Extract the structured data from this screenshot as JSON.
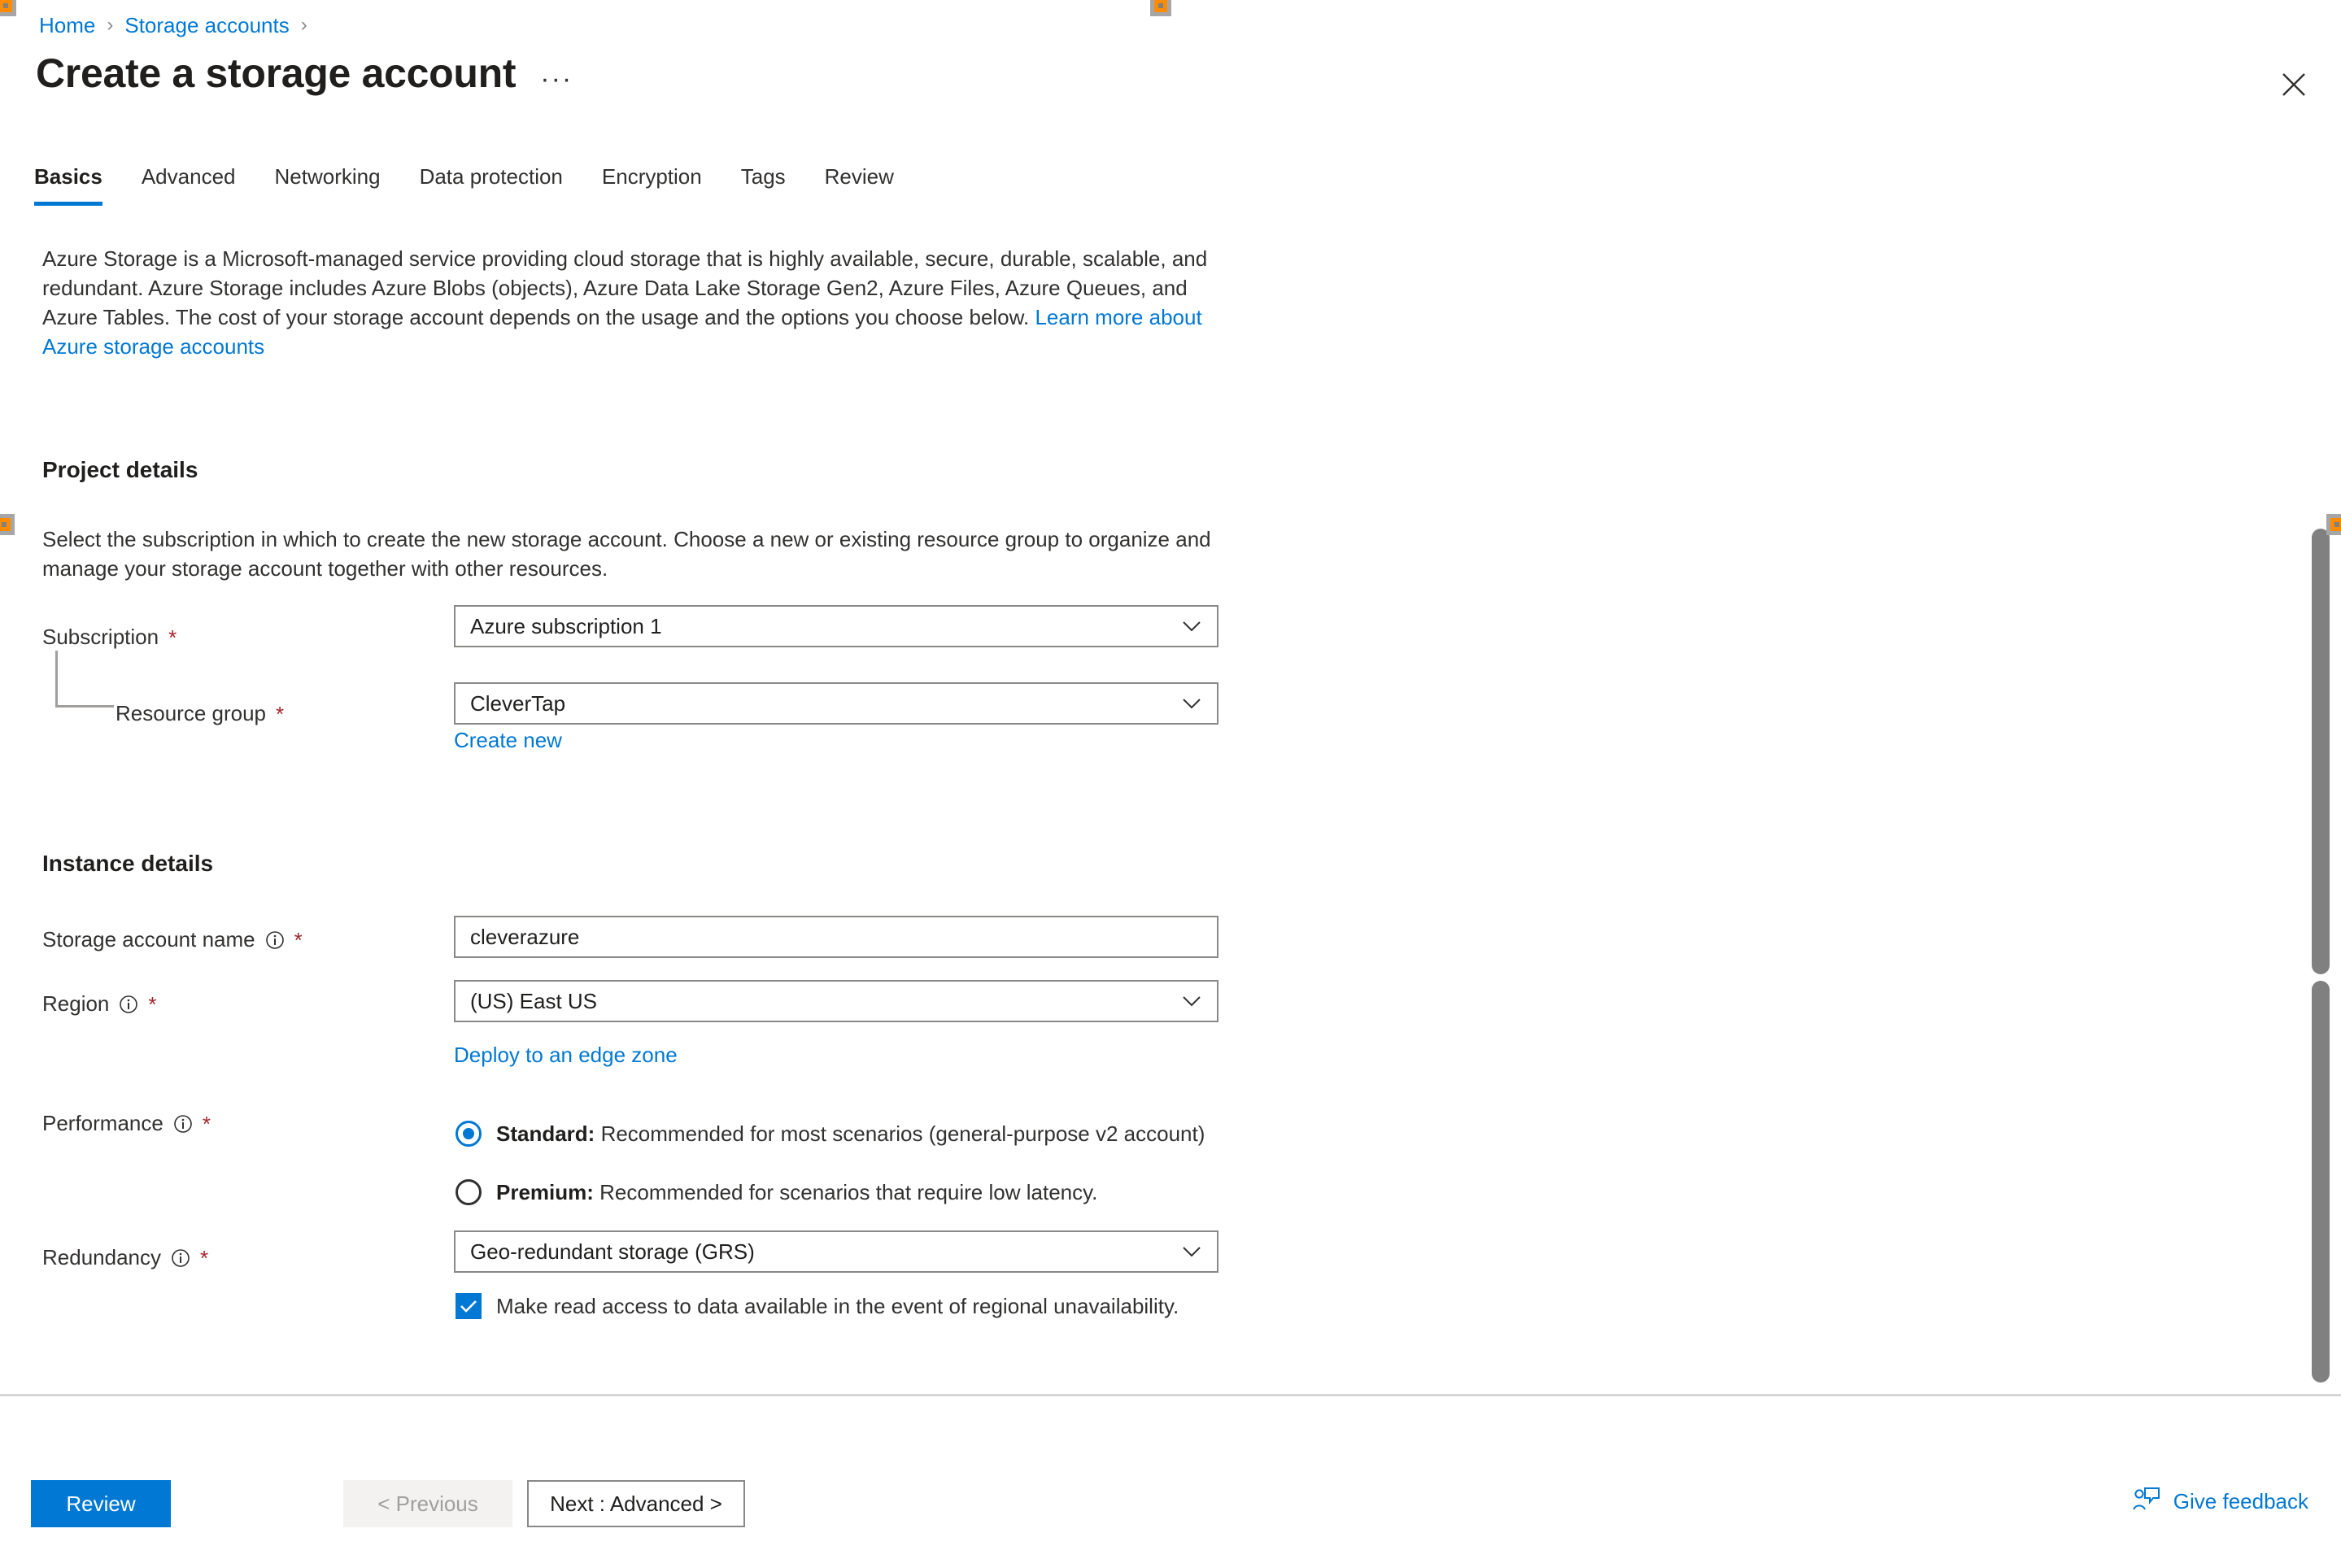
{
  "breadcrumb": {
    "items": [
      {
        "label": "Home"
      },
      {
        "label": "Storage accounts"
      }
    ],
    "separator": "›"
  },
  "header": {
    "title": "Create a storage account",
    "ellipsis": "···",
    "close_label": "Close"
  },
  "tabs": [
    {
      "label": "Basics",
      "active": true
    },
    {
      "label": "Advanced",
      "active": false
    },
    {
      "label": "Networking",
      "active": false
    },
    {
      "label": "Data protection",
      "active": false
    },
    {
      "label": "Encryption",
      "active": false
    },
    {
      "label": "Tags",
      "active": false
    },
    {
      "label": "Review",
      "active": false
    }
  ],
  "intro": {
    "text": "Azure Storage is a Microsoft-managed service providing cloud storage that is highly available, secure, durable, scalable, and redundant. Azure Storage includes Azure Blobs (objects), Azure Data Lake Storage Gen2, Azure Files, Azure Queues, and Azure Tables. The cost of your storage account depends on the usage and the options you choose below. ",
    "link": "Learn more about Azure storage accounts"
  },
  "project_details": {
    "heading": "Project details",
    "description": "Select the subscription in which to create the new storage account. Choose a new or existing resource group to organize and manage your storage account together with other resources.",
    "subscription": {
      "label": "Subscription",
      "required": "*",
      "value": "Azure subscription 1"
    },
    "resource_group": {
      "label": "Resource group",
      "required": "*",
      "value": "CleverTap",
      "create_new": "Create new"
    }
  },
  "instance_details": {
    "heading": "Instance details",
    "storage_account_name": {
      "label": "Storage account name",
      "required": "*",
      "value": "cleverazure",
      "placeholder": ""
    },
    "region": {
      "label": "Region",
      "required": "*",
      "value": "(US) East US",
      "edge_zone_link": "Deploy to an edge zone"
    },
    "performance": {
      "label": "Performance",
      "required": "*",
      "options": [
        {
          "bold": "Standard:",
          "text": " Recommended for most scenarios (general-purpose v2 account)",
          "selected": true
        },
        {
          "bold": "Premium:",
          "text": " Recommended for scenarios that require low latency.",
          "selected": false
        }
      ]
    },
    "redundancy": {
      "label": "Redundancy",
      "required": "*",
      "value": "Geo-redundant storage (GRS)",
      "checkbox_label": "Make read access to data available in the event of regional unavailability.",
      "checkbox_checked": true
    }
  },
  "footer": {
    "review_label": "Review",
    "previous_label": "< Previous",
    "next_label": "Next : Advanced >",
    "feedback_label": "Give feedback"
  },
  "colors": {
    "accent": "#0078d4",
    "required_star": "#a4262c",
    "text": "#323130",
    "border": "#8a8886",
    "marker": "#ff8c00"
  }
}
